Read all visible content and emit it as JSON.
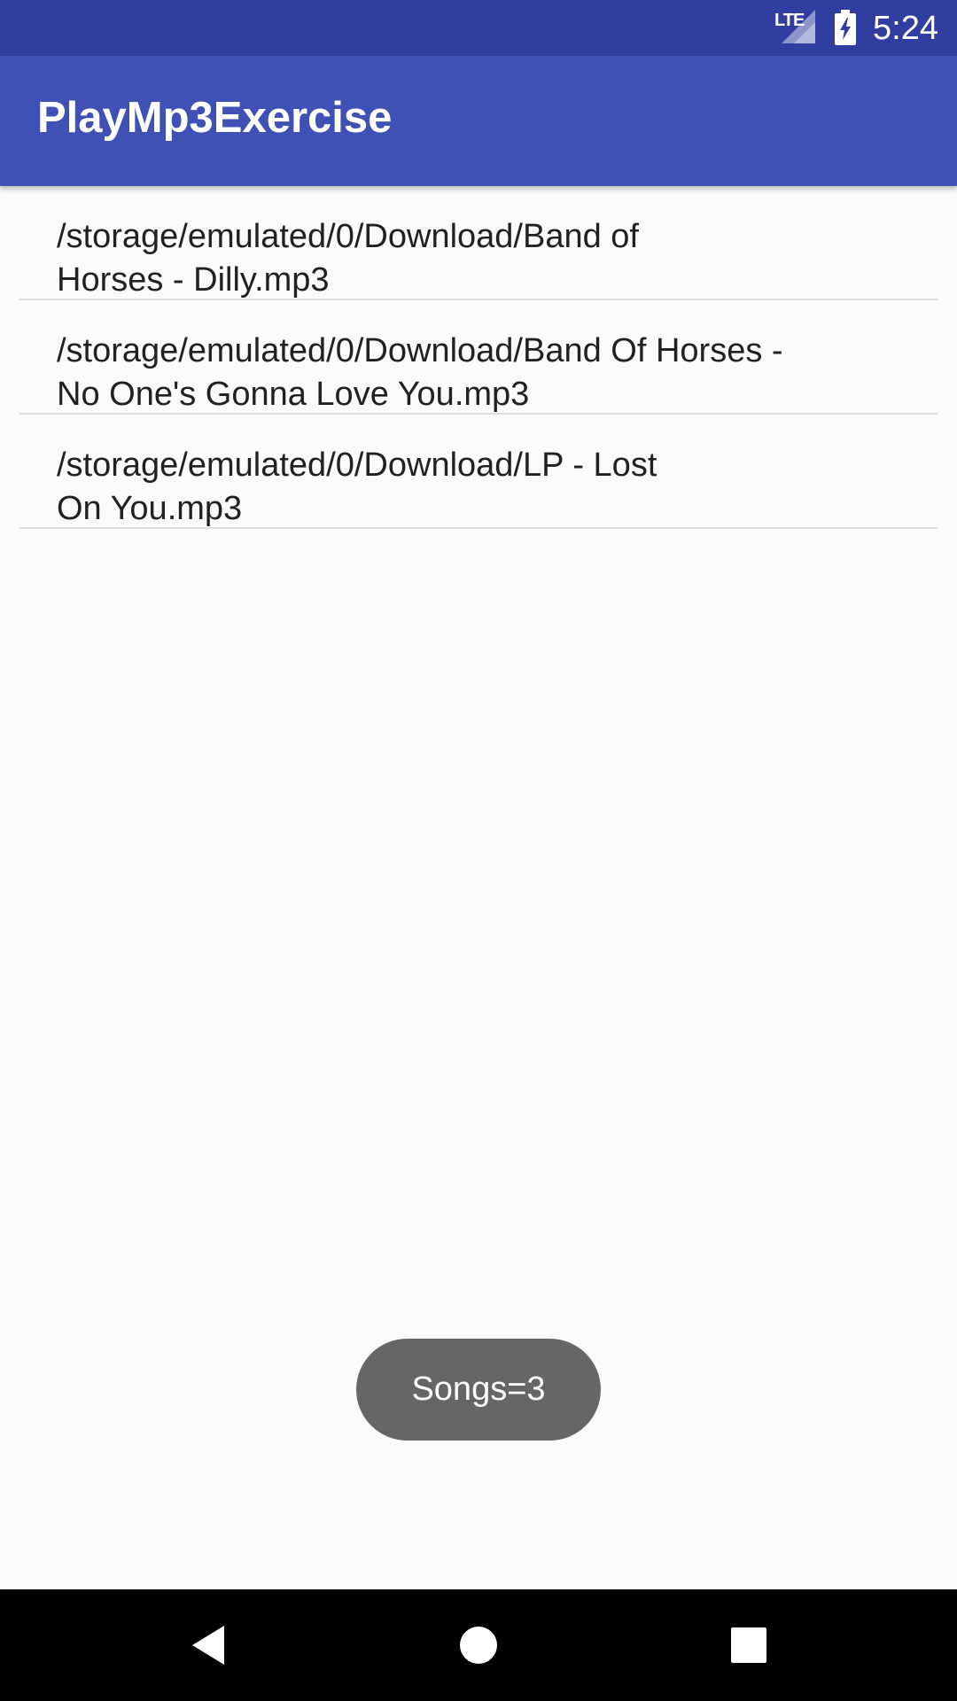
{
  "status_bar": {
    "network": "LTE",
    "time": "5:24",
    "icons": [
      "signal-icon",
      "battery-charging-icon"
    ]
  },
  "app_bar": {
    "title": "PlayMp3Exercise"
  },
  "songs": [
    "/storage/emulated/0/Download/Band of\nHorses - Dilly.mp3",
    "/storage/emulated/0/Download/Band Of Horses -\nNo One's Gonna Love You.mp3",
    "/storage/emulated/0/Download/LP - Lost\nOn You.mp3"
  ],
  "toast": {
    "text": "Songs=3"
  },
  "nav_bar": {
    "icons": [
      "back-icon",
      "home-icon",
      "recents-icon"
    ]
  },
  "colors": {
    "status_bar": "#303f9f",
    "app_bar": "#3f51b5",
    "background": "#fafafa",
    "toast": "#666666"
  }
}
